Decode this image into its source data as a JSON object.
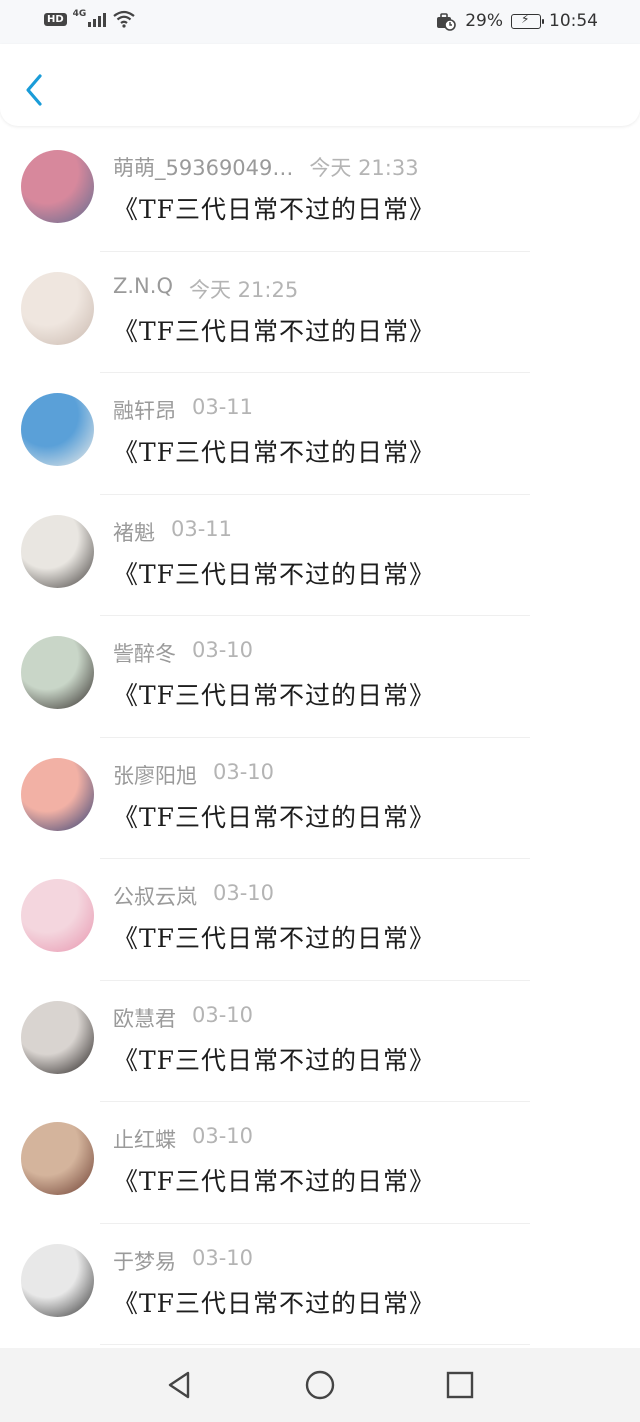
{
  "status_bar": {
    "hd_badge": "HD",
    "network": "4G",
    "battery_percent": "29%",
    "time": "10:54"
  },
  "nav": {
    "back_icon": "chevron-left-icon",
    "accent_color": "#1a9cd8"
  },
  "rows": [
    {
      "name": "萌萌_59369049…",
      "time": "今天 21:33",
      "title": "《TF三代日常不过的日常》",
      "avatar_colors": [
        "#d7889c",
        "#5b6b90"
      ]
    },
    {
      "name": "Z.N.Q",
      "time": "今天 21:25",
      "title": "《TF三代日常不过的日常》",
      "avatar_colors": [
        "#efe6df",
        "#c8b7ad"
      ]
    },
    {
      "name": "融轩昂",
      "time": "03-11",
      "title": "《TF三代日常不过的日常》",
      "avatar_colors": [
        "#5aa0d8",
        "#f2efe9"
      ]
    },
    {
      "name": "褚魁",
      "time": "03-11",
      "title": "《TF三代日常不过的日常》",
      "avatar_colors": [
        "#e9e6e1",
        "#3e3a38"
      ]
    },
    {
      "name": "訾醉冬",
      "time": "03-10",
      "title": "《TF三代日常不过的日常》",
      "avatar_colors": [
        "#c9d6c8",
        "#2d2624"
      ]
    },
    {
      "name": "张廖阳旭",
      "time": "03-10",
      "title": "《TF三代日常不过的日常》",
      "avatar_colors": [
        "#f2b1a5",
        "#2e3e74"
      ]
    },
    {
      "name": "公叔云岚",
      "time": "03-10",
      "title": "《TF三代日常不过的日常》",
      "avatar_colors": [
        "#f4d6de",
        "#e793ad"
      ]
    },
    {
      "name": "欧慧君",
      "time": "03-10",
      "title": "《TF三代日常不过的日常》",
      "avatar_colors": [
        "#d9d4d0",
        "#1f1b1a"
      ]
    },
    {
      "name": "止红蝶",
      "time": "03-10",
      "title": "《TF三代日常不过的日常》",
      "avatar_colors": [
        "#d4b49c",
        "#6a3b2f"
      ]
    },
    {
      "name": "于梦易",
      "time": "03-10",
      "title": "《TF三代日常不过的日常》",
      "avatar_colors": [
        "#e8e8e8",
        "#2f2f2f"
      ]
    }
  ],
  "system_nav": {
    "back": "triangle-back-icon",
    "home": "circle-home-icon",
    "recents": "square-recents-icon"
  }
}
